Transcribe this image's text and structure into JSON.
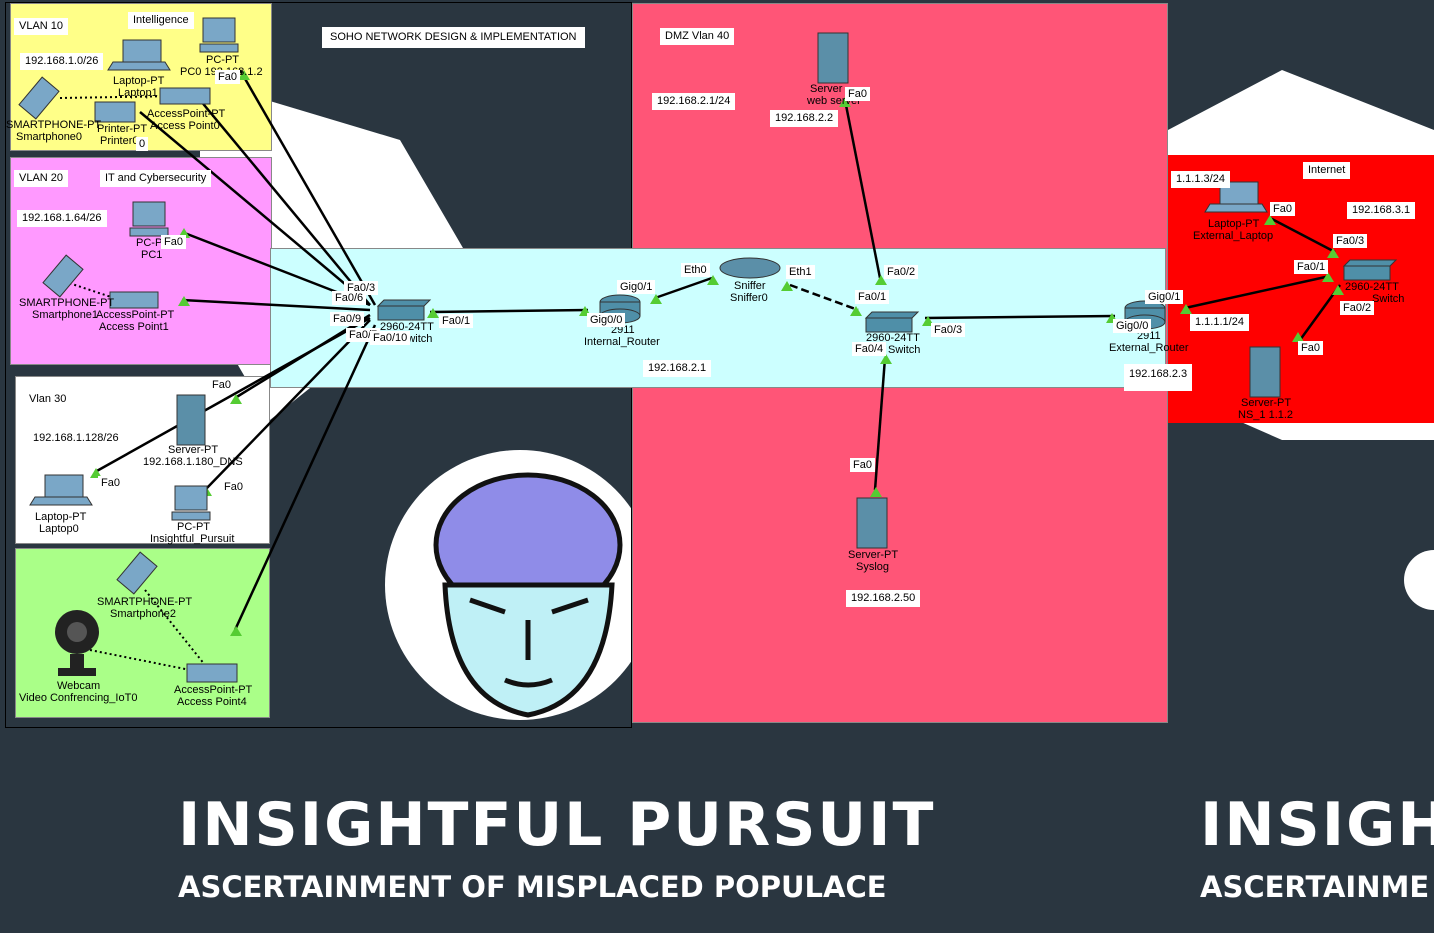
{
  "title": "SOHO NETWORK DESIGN & IMPLEMENTATION",
  "zones": {
    "vlan10": {
      "name": "VLAN 10",
      "dept": "Intelligence",
      "subnet": "192.168.1.0/26",
      "color": "#ffff88"
    },
    "vlan20": {
      "name": "VLAN 20",
      "dept": "IT and Cybersecurity",
      "subnet": "192.168.1.64/26",
      "color": "#ff99ff"
    },
    "vlan30": {
      "name": "Vlan 30",
      "subnet": "192.168.1.128/26",
      "color": "#ffffff"
    },
    "vlan40": {
      "color": "#aaff88"
    },
    "core": {
      "color": "#ccffff"
    },
    "dmz": {
      "name": "DMZ Vlan 40",
      "subnet": "192.168.2.1/24",
      "color": "#ff5577"
    },
    "internet": {
      "name": "Internet",
      "color": "#ff0000"
    }
  },
  "devices": {
    "laptop1": {
      "type": "Laptop-PT",
      "name": "Laptop1"
    },
    "pc0": {
      "type": "PC-PT",
      "name": "PC0 192.168.1.2"
    },
    "smartphone0": {
      "type": "SMARTPHONE-PT",
      "name": "Smartphone0"
    },
    "printer0": {
      "type": "Printer-PT",
      "name": "Printer0"
    },
    "ap0": {
      "type": "AccessPoint-PT",
      "name": "Access Point0"
    },
    "pc1": {
      "type": "PC-PT",
      "name": "PC1"
    },
    "smartphone1": {
      "type": "SMARTPHONE-PT",
      "name": "Smartphone1"
    },
    "ap1": {
      "type": "AccessPoint-PT",
      "name": "Access Point1"
    },
    "dns_server": {
      "type": "Server-PT",
      "name": "192.168.1.180_DNS"
    },
    "laptop0": {
      "type": "Laptop-PT",
      "name": "Laptop0"
    },
    "pc_ip": {
      "type": "PC-PT",
      "name": "Insightful_Pursuit"
    },
    "smartphone2": {
      "type": "SMARTPHONE-PT",
      "name": "Smartphone2"
    },
    "webcam": {
      "type": "Webcam",
      "name": "Video Confrencing_IoT0"
    },
    "ap4": {
      "type": "AccessPoint-PT",
      "name": "Access Point4"
    },
    "core_switch": {
      "type": "2960-24TT",
      "name": "Switch"
    },
    "internal_router": {
      "type": "2911",
      "name": "Internal_Router"
    },
    "sniffer": {
      "type": "Sniffer",
      "name": "Sniffer0"
    },
    "web_server": {
      "type": "Server",
      "name": "web server"
    },
    "dmz_switch": {
      "type": "2960-24TT",
      "name": "Switch"
    },
    "syslog": {
      "type": "Server-PT",
      "name": "Syslog"
    },
    "external_router": {
      "type": "2911",
      "name": "External_Router"
    },
    "ext_laptop": {
      "type": "Laptop-PT",
      "name": "External_Laptop"
    },
    "inet_switch": {
      "type": "2960-24TT",
      "name": "Switch"
    },
    "ns_server": {
      "type": "Server-PT",
      "name": "NS_1 1.1.2"
    }
  },
  "ip_labels": {
    "web_ip": "192.168.2.2",
    "router_ip": "192.168.2.1",
    "ext_router_ip": "192.168.2.3",
    "syslog_ip": "192.168.2.50",
    "ext_laptop_ip": "1.1.1.3/24",
    "inet_subnet": "192.168.3.1",
    "ext_gig_ip": "1.1.1.1/24"
  },
  "ports": {
    "fa0": "Fa0",
    "fa0_1": "Fa0/1",
    "fa0_2": "Fa0/2",
    "fa0_3": "Fa0/3",
    "fa0_4": "Fa0/4",
    "fa0_6": "Fa0/6",
    "fa0_7": "Fa0/7",
    "fa0_9": "Fa0/9",
    "fa0_10": "Fa0/10",
    "gig0_0": "Gig0/0",
    "gig0_1": "Gig0/1",
    "eth0": "Eth0",
    "eth1": "Eth1",
    "zero": "0"
  },
  "branding": {
    "headline": "INSIGHTFUL PURSUIT",
    "tagline": "ASCERTAINMENT OF MISPLACED POPULACE",
    "headline_clip": "INSIGHT",
    "tagline_clip": "ASCERTAINME"
  }
}
